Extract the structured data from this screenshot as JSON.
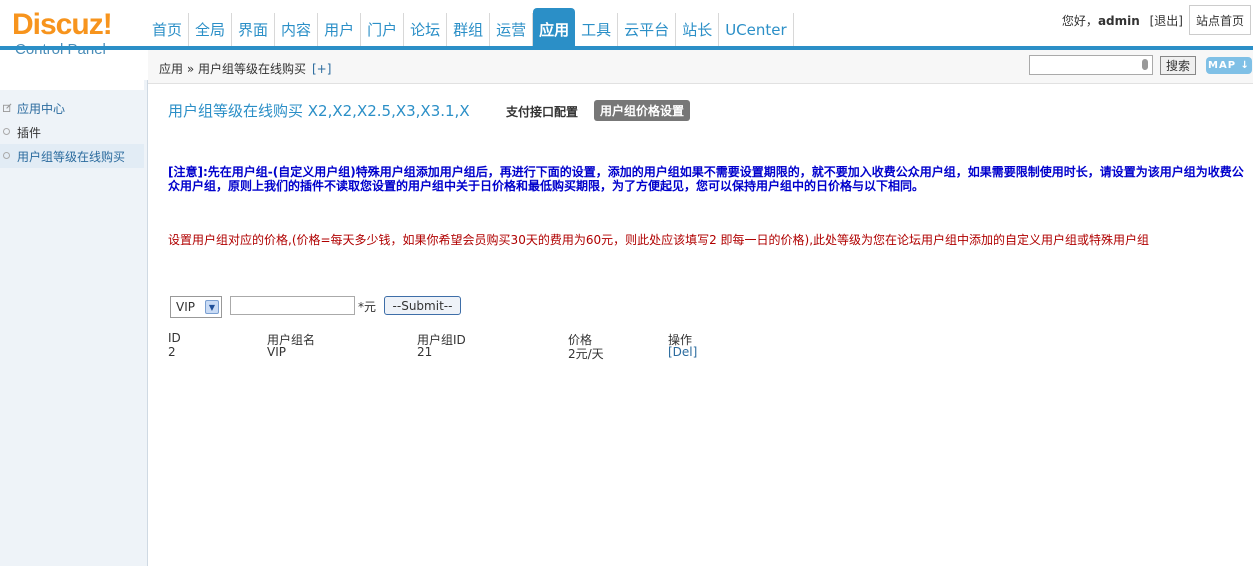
{
  "logo": {
    "brand": "Discuz!",
    "subtitle": "Control Panel"
  },
  "nav": {
    "items": [
      "首页",
      "全局",
      "界面",
      "内容",
      "用户",
      "门户",
      "论坛",
      "群组",
      "运营",
      "应用",
      "工具",
      "云平台",
      "站长",
      "UCenter"
    ],
    "active_index": 9
  },
  "userbar": {
    "greeting": "您好，",
    "username": "admin",
    "logout": "[退出]",
    "site_home": "站点首页"
  },
  "breadcrumb": {
    "path": "应用 » 用户组等级在线购买",
    "add": "[+]"
  },
  "search": {
    "value": "",
    "button": "搜索",
    "map": "MAP ↓"
  },
  "sidebar": {
    "items": [
      {
        "label": "应用中心",
        "icon": "edit-icon"
      },
      {
        "label": "插件",
        "icon": "circle-icon"
      },
      {
        "label": "用户组等级在线购买",
        "icon": "circle-icon"
      }
    ]
  },
  "main": {
    "title": "用户组等级在线购买 X2,X2,X2.5,X3,X3.1,X",
    "tab_payment": "支付接口配置",
    "tab_price": "用户组价格设置",
    "notice": "[注意]:先在用户组-(自定义用户组)特殊用户组添加用户组后，再进行下面的设置，添加的用户组如果不需要设置期限的，就不要加入收费公众用户组，如果需要限制使用时长，请设置为该用户组为收费公众用户组，原则上我们的插件不读取您设置的用户组中关于日价格和最低购买期限，为了方便起见，您可以保持用户组中的日价格与以下相同。",
    "description": "设置用户组对应的价格,(价格=每天多少钱，如果你希望会员购买30天的费用为60元，则此处应该填写2 即每一日的价格),此处等级为您在论坛用户组中添加的自定义用户组或特殊用户组",
    "form": {
      "selected_group": "VIP",
      "price_value": "",
      "unit": "*元",
      "submit": "--Submit--"
    },
    "table": {
      "headers": [
        "ID",
        "用户组名",
        "用户组ID",
        "价格",
        "操作"
      ],
      "rows": [
        {
          "id": "2",
          "name": "VIP",
          "group_id": "21",
          "price": "2元/天",
          "action": "[Del]"
        }
      ]
    }
  }
}
